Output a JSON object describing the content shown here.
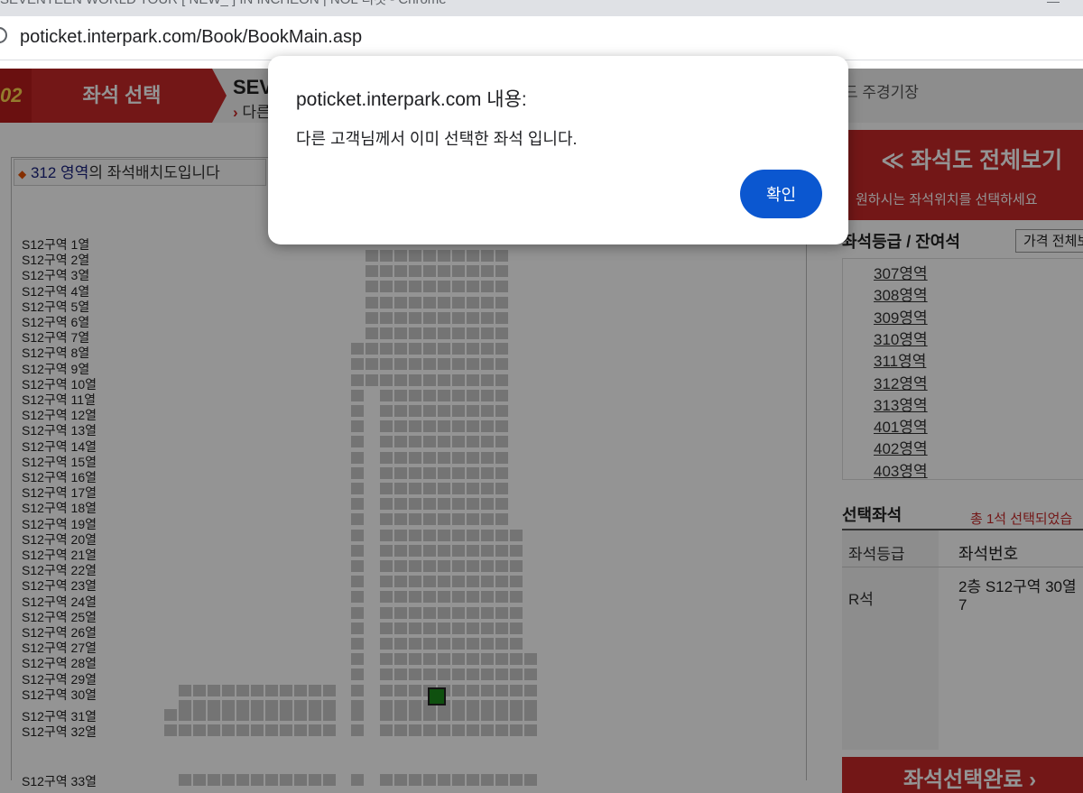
{
  "browser": {
    "window_title": "SEVENTEEN WORLD TOUR  [ NEW_ ]  IN INCHEON | NOL 티켓 - Chrome",
    "url": "poticket.interpark.com/Book/BookMain.asp"
  },
  "header": {
    "step_number": "02",
    "step_label": "좌석 선택",
    "event_title": "SEV",
    "event_sub": "다른",
    "venue": "드 주경기장"
  },
  "seatmap": {
    "zone_label_prefix": "312 영역",
    "zone_label_suffix": "의 좌석배치도입니다",
    "rows": [
      "S12구역 1열",
      "S12구역 2열",
      "S12구역 3열",
      "S12구역 4열",
      "S12구역 5열",
      "S12구역 6열",
      "S12구역 7열",
      "S12구역 8열",
      "S12구역 9열",
      "S12구역 10열",
      "S12구역 11열",
      "S12구역 12열",
      "S12구역 13열",
      "S12구역 14열",
      "S12구역 15열",
      "S12구역 16열",
      "S12구역 17열",
      "S12구역 18열",
      "S12구역 19열",
      "S12구역 20열",
      "S12구역 21열",
      "S12구역 22열",
      "S12구역 23열",
      "S12구역 24열",
      "S12구역 25열",
      "S12구역 26열",
      "S12구역 27열",
      "S12구역 28열",
      "S12구역 29열",
      "S12구역 30열",
      "S12구역 31열",
      "S12구역 32열",
      "S12구역 33열"
    ],
    "selected_seat_color": "#1b8a1b"
  },
  "side": {
    "banner_title": "≪ 좌석도 전체보기",
    "banner_sub": "원하시는 좌석위치를 선택하세요",
    "grade_head": "좌석등급 / 잔여석",
    "price_button": "가격 전체보",
    "zones": [
      "307영역",
      "308영역",
      "309영역",
      "310영역",
      "311영역",
      "312영역",
      "313영역",
      "401영역",
      "402영역",
      "403영역"
    ],
    "selected_head": "선택좌석",
    "selected_count": "총 1석 선택되었습",
    "col_grade": "좌석등급",
    "col_seat": "좌석번호",
    "grade_value": "R석",
    "seat_value_line1": "2층 S12구역 30열",
    "seat_value_line2": "7",
    "complete_button": "좌석선택완료",
    "brand_color": "#c62828"
  },
  "dialog": {
    "title": "poticket.interpark.com 내용:",
    "message": "다른 고객님께서 이미 선택한 좌석 입니다.",
    "ok_label": "확인",
    "button_color": "#0b57d0"
  }
}
